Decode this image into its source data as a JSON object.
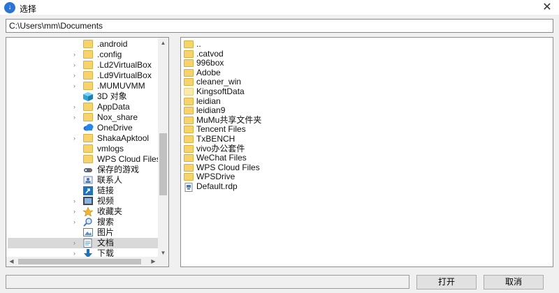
{
  "window": {
    "title": "选择",
    "close_glyph": "✕"
  },
  "path": {
    "value": "C:\\Users\\mm\\Documents"
  },
  "tree": {
    "items": [
      {
        "label": ".android",
        "icon": "folder-icon",
        "expand": false
      },
      {
        "label": ".config",
        "icon": "folder-icon",
        "expand": true
      },
      {
        "label": ".Ld2VirtualBox",
        "icon": "folder-icon",
        "expand": true
      },
      {
        "label": ".Ld9VirtualBox",
        "icon": "folder-icon",
        "expand": true
      },
      {
        "label": ".MUMUVMM",
        "icon": "folder-icon",
        "expand": true
      },
      {
        "label": "3D 对象",
        "icon": "cube-icon",
        "expand": false
      },
      {
        "label": "AppData",
        "icon": "folder-icon",
        "expand": true
      },
      {
        "label": "Nox_share",
        "icon": "folder-icon",
        "expand": true
      },
      {
        "label": "OneDrive",
        "icon": "cloud-icon",
        "expand": false
      },
      {
        "label": "ShakaApktool",
        "icon": "folder-icon",
        "expand": true
      },
      {
        "label": "vmlogs",
        "icon": "folder-icon",
        "expand": false
      },
      {
        "label": "WPS Cloud Files",
        "icon": "folder-icon",
        "expand": false
      },
      {
        "label": "保存的游戏",
        "icon": "game-icon",
        "expand": false
      },
      {
        "label": "联系人",
        "icon": "contacts-icon",
        "expand": false
      },
      {
        "label": "链接",
        "icon": "link-icon",
        "expand": false
      },
      {
        "label": "视频",
        "icon": "video-icon",
        "expand": true
      },
      {
        "label": "收藏夹",
        "icon": "star-icon",
        "expand": true
      },
      {
        "label": "搜索",
        "icon": "search-icon",
        "expand": true
      },
      {
        "label": "图片",
        "icon": "pictures-icon",
        "expand": false
      },
      {
        "label": "文档",
        "icon": "documents-icon",
        "expand": true,
        "selected": true
      },
      {
        "label": "下载",
        "icon": "download-icon",
        "expand": true
      }
    ],
    "expand_glyph": "›"
  },
  "files": {
    "items": [
      {
        "label": "..",
        "icon": "folder-icon"
      },
      {
        "label": ".catvod",
        "icon": "folder-icon"
      },
      {
        "label": "996box",
        "icon": "folder-icon"
      },
      {
        "label": "Adobe",
        "icon": "folder-icon"
      },
      {
        "label": "cleaner_win",
        "icon": "folder-icon"
      },
      {
        "label": "KingsoftData",
        "icon": "folder-pale-icon"
      },
      {
        "label": "leidian",
        "icon": "folder-icon"
      },
      {
        "label": "leidian9",
        "icon": "folder-icon"
      },
      {
        "label": "MuMu共享文件夹",
        "icon": "folder-icon"
      },
      {
        "label": "Tencent Files",
        "icon": "folder-icon"
      },
      {
        "label": "TxBENCH",
        "icon": "folder-icon"
      },
      {
        "label": "vivo办公套件",
        "icon": "folder-icon"
      },
      {
        "label": "WeChat Files",
        "icon": "folder-icon"
      },
      {
        "label": "WPS Cloud Files",
        "icon": "folder-icon"
      },
      {
        "label": "WPSDrive",
        "icon": "folder-icon"
      },
      {
        "label": "Default.rdp",
        "icon": "rdp-file-icon"
      }
    ]
  },
  "buttons": {
    "open": "打开",
    "cancel": "取消"
  },
  "colors": {
    "folder": "#f6d36b",
    "selection": "#d9d9d9",
    "accent": "#2a74d8"
  }
}
